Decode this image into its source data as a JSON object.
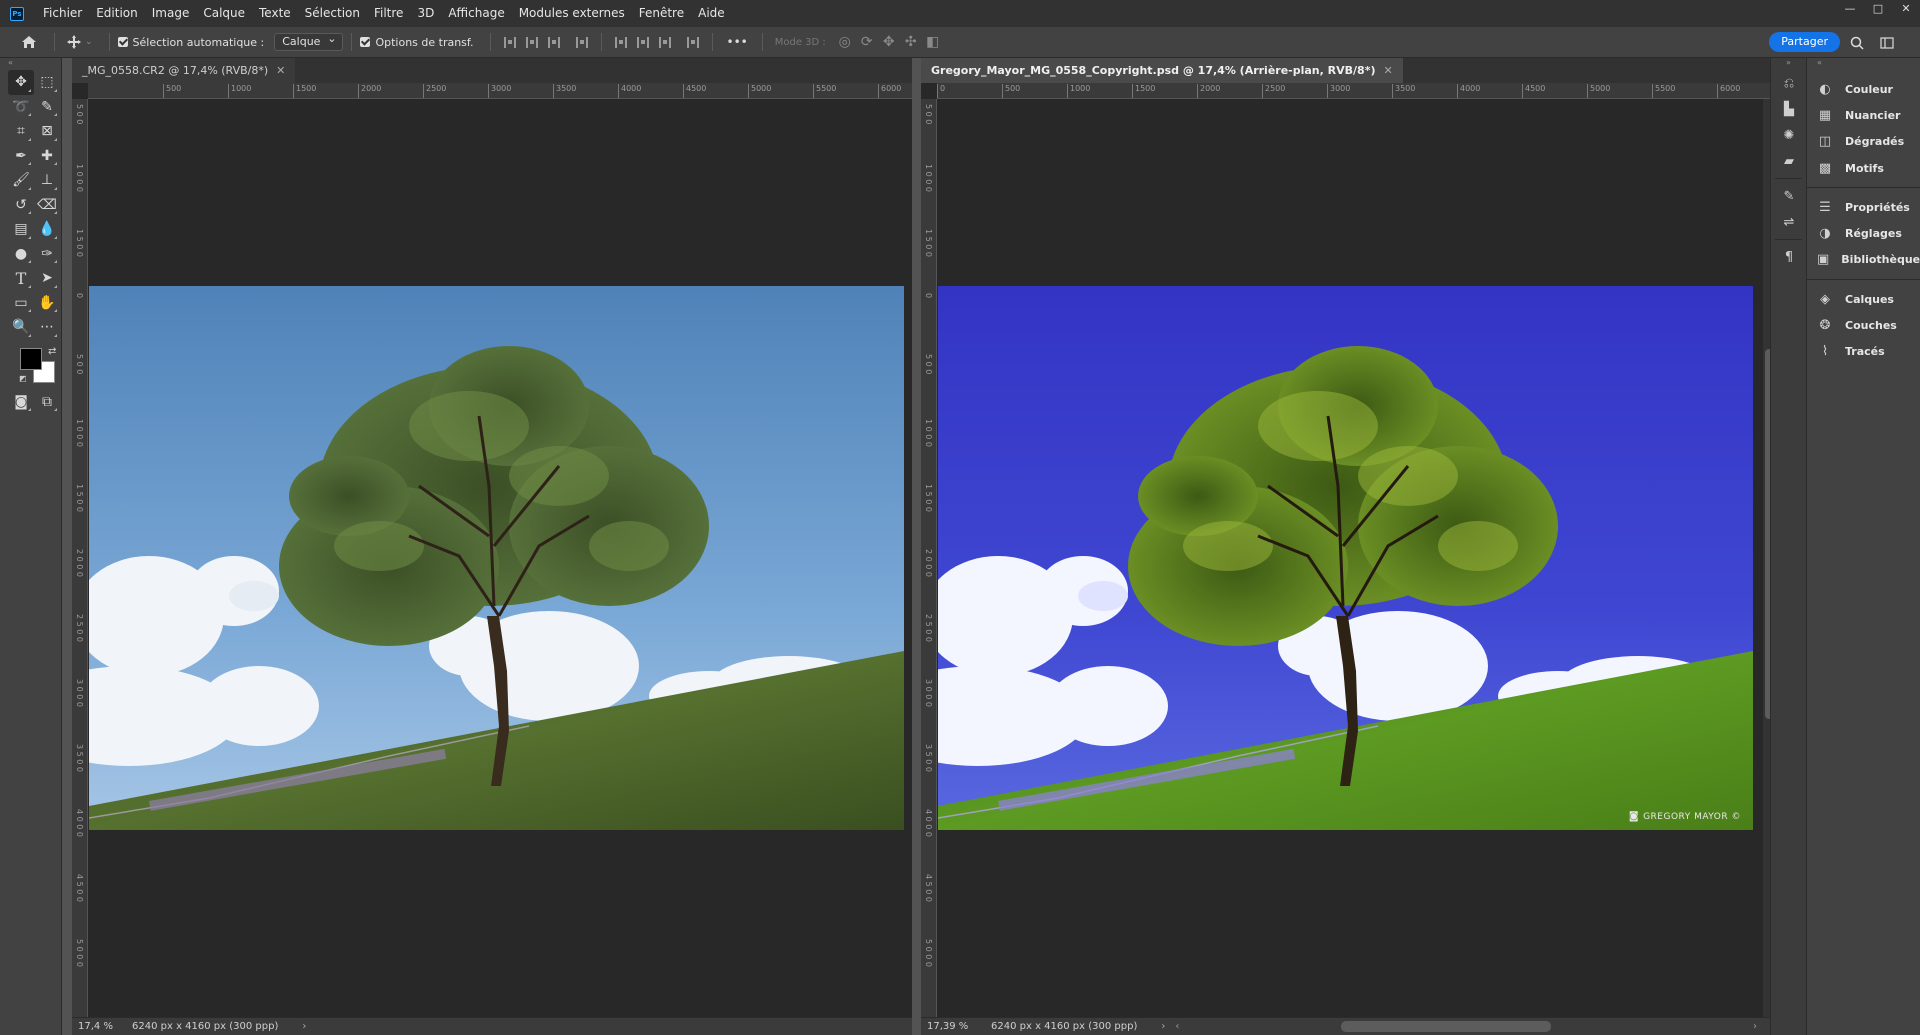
{
  "app": {
    "logo": "Ps"
  },
  "menu": [
    "Fichier",
    "Edition",
    "Image",
    "Calque",
    "Texte",
    "Sélection",
    "Filtre",
    "3D",
    "Affichage",
    "Modules externes",
    "Fenêtre",
    "Aide"
  ],
  "window_controls": {
    "minimize": "—",
    "maximize": "□",
    "close": "✕"
  },
  "options": {
    "auto_select_label": "Sélection automatique :",
    "auto_select_value": "Calque",
    "transform_label": "Options de transf.",
    "more_label": "•••",
    "mode3d_label": "Mode 3D :",
    "share_label": "Partager"
  },
  "documents": [
    {
      "tab_title": "_MG_0558.CR2 @ 17,4% (RVB/8*)",
      "zoom": "17,4 %",
      "info": "6240 px x 4160 px (300 ppp)",
      "ruler_h": [
        "500",
        "1000",
        "1500",
        "2000",
        "2500",
        "3000",
        "3500",
        "4000",
        "4500",
        "5000",
        "5500",
        "6000"
      ],
      "ruler_v": [
        "5 0 0",
        "1 0 0 0",
        "1 5 0 0",
        "0",
        "5 0 0",
        "1 0 0 0",
        "1 5 0 0",
        "2 0 0 0",
        "2 5 0 0",
        "3 0 0 0",
        "3 5 0 0",
        "4 0 0 0",
        "4 5 0 0",
        "5 0 0 0"
      ],
      "arrow": "›"
    },
    {
      "tab_title": "Gregory_Mayor_MG_0558_Copyright.psd @ 17,4% (Arrière-plan, RVB/8*)",
      "zoom": "17,39 %",
      "info": "6240 px x 4160 px (300 ppp)",
      "ruler_h": [
        "0",
        "500",
        "1000",
        "1500",
        "2000",
        "2500",
        "3000",
        "3500",
        "4000",
        "4500",
        "5000",
        "5500",
        "6000"
      ],
      "ruler_v": [
        "5 0 0",
        "1 0 0 0",
        "1 5 0 0",
        "0",
        "5 0 0",
        "1 0 0 0",
        "1 5 0 0",
        "2 0 0 0",
        "2 5 0 0",
        "3 0 0 0",
        "3 5 0 0",
        "4 0 0 0",
        "4 5 0 0",
        "5 0 0 0"
      ],
      "watermark": "GREGORY MAYOR ©",
      "arrow": "›",
      "scroll_left": "‹",
      "scroll_right": "›"
    }
  ],
  "panels": {
    "group1": [
      {
        "label": "Couleur",
        "icon": "color-wheel-icon"
      },
      {
        "label": "Nuancier",
        "icon": "swatches-grid-icon"
      },
      {
        "label": "Dégradés",
        "icon": "gradient-icon"
      },
      {
        "label": "Motifs",
        "icon": "patterns-icon"
      }
    ],
    "group2": [
      {
        "label": "Propriétés",
        "icon": "sliders-icon"
      },
      {
        "label": "Réglages",
        "icon": "half-circle-icon"
      },
      {
        "label": "Bibliothèques",
        "icon": "library-icon"
      }
    ],
    "group3": [
      {
        "label": "Calques",
        "icon": "layers-icon"
      },
      {
        "label": "Couches",
        "icon": "channels-icon"
      },
      {
        "label": "Tracés",
        "icon": "paths-icon"
      }
    ]
  },
  "colors": {
    "accent": "#1473e6",
    "foreground": "#000000",
    "background": "#ffffff"
  }
}
